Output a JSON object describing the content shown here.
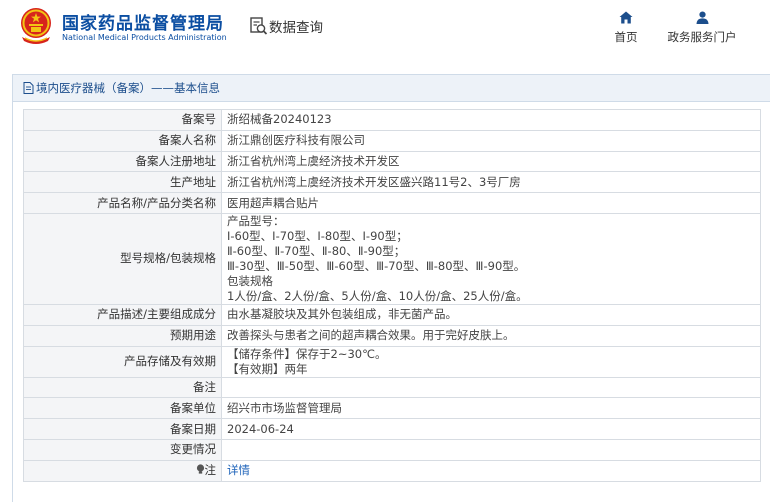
{
  "header": {
    "logo_cn": "国家药品监督管理局",
    "logo_en": "National Medical Products Administration",
    "query_label": "数据查询",
    "query_icon": "search-document-icon",
    "nav": [
      {
        "label": "首页",
        "icon": "home-icon"
      },
      {
        "label": "政务服务门户",
        "icon": "user-icon"
      }
    ]
  },
  "panel": {
    "title": "境内医疗器械（备案）——基本信息",
    "title_icon": "document-icon"
  },
  "record": {
    "rows": [
      {
        "label": "备案号",
        "value": "浙绍械备20240123"
      },
      {
        "label": "备案人名称",
        "value": "浙江鼎创医疗科技有限公司"
      },
      {
        "label": "备案人注册地址",
        "value": "浙江省杭州湾上虞经济技术开发区"
      },
      {
        "label": "生产地址",
        "value": "浙江省杭州湾上虞经济技术开发区盛兴路11号2、3号厂房"
      },
      {
        "label": "产品名称/产品分类名称",
        "value": "医用超声耦合贴片"
      },
      {
        "label": "型号规格/包装规格",
        "lines": [
          "产品型号：",
          "Ⅰ-60型、Ⅰ-70型、Ⅰ-80型、Ⅰ-90型；",
          "Ⅱ-60型、Ⅱ-70型、Ⅱ-80、Ⅱ-90型；",
          "Ⅲ-30型、Ⅲ-50型、Ⅲ-60型、Ⅲ-70型、Ⅲ-80型、Ⅲ-90型。",
          "包装规格",
          "1人份/盒、2人份/盒、5人份/盒、10人份/盒、25人份/盒。"
        ]
      },
      {
        "label": "产品描述/主要组成成分",
        "value": "由水基凝胶块及其外包装组成，非无菌产品。"
      },
      {
        "label": "预期用途",
        "value": "改善探头与患者之间的超声耦合效果。用于完好皮肤上。"
      },
      {
        "label": "产品存储及有效期",
        "lines": [
          "【储存条件】保存于2~30℃。",
          "【有效期】两年"
        ]
      },
      {
        "label": "备注",
        "value": ""
      },
      {
        "label": "备案单位",
        "value": "绍兴市市场监督管理局"
      },
      {
        "label": "备案日期",
        "value": "2024-06-24"
      },
      {
        "label": "变更情况",
        "value": ""
      },
      {
        "label": "注",
        "value": "详情",
        "label_icon": "bulb-icon"
      }
    ]
  },
  "colors": {
    "brand_blue": "#0b4ea2",
    "logo_red": "#d7241c",
    "logo_gold": "#f3c313",
    "link": "#1c62b9",
    "label_bg": "#f4f5f7"
  }
}
